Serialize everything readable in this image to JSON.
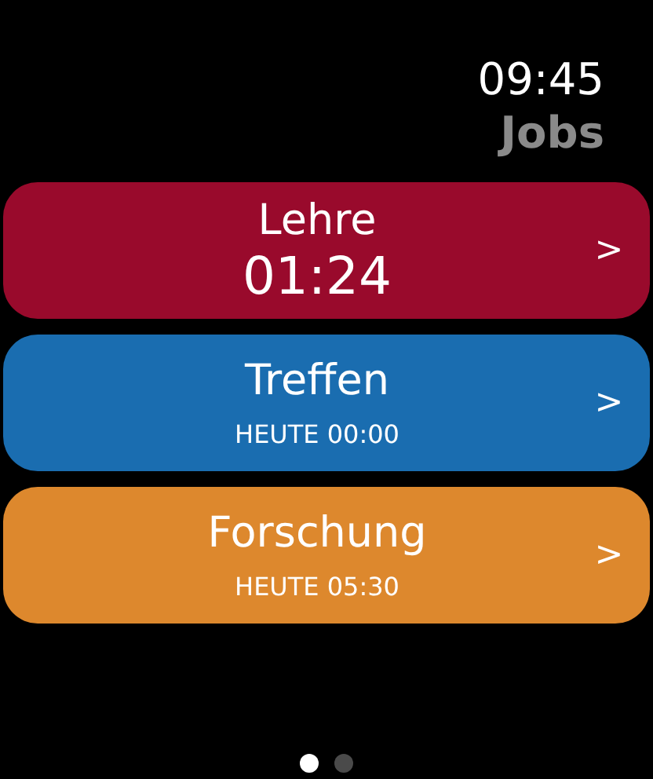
{
  "status_bar": {
    "time": "09:45"
  },
  "title": "Jobs",
  "jobs": [
    {
      "kind": "running",
      "name": "Lehre",
      "detail": "01:24",
      "chevron": ">",
      "color": "#990a2c"
    },
    {
      "kind": "scheduled",
      "name": "Treffen",
      "detail": "HEUTE 00:00",
      "chevron": ">",
      "color": "#1a6db0"
    },
    {
      "kind": "scheduled",
      "name": "Forschung",
      "detail": "HEUTE 05:30",
      "chevron": ">",
      "color": "#dd882d"
    }
  ],
  "pages": [
    {
      "selected": true
    },
    {
      "selected": false
    }
  ]
}
